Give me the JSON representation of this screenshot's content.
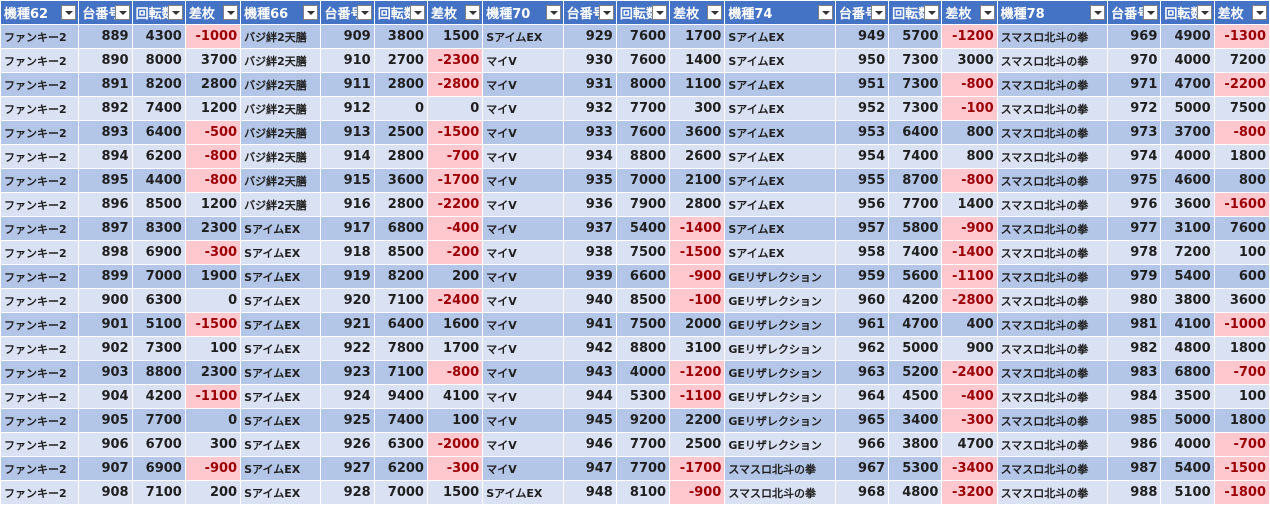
{
  "headers": [
    "機種62",
    "台番号",
    "回転数",
    "差枚",
    "機種66",
    "台番号",
    "回転数",
    "差枚",
    "機種70",
    "台番号",
    "回転数",
    "差枚",
    "機種74",
    "台番号",
    "回転数",
    "差枚",
    "機種78",
    "台番号",
    "回転数",
    "差枚"
  ],
  "neg_fill_color": "#ffc7ce",
  "header_color": "#4472c4",
  "rows": [
    [
      "ファンキー2",
      "889",
      "4300",
      "-1000",
      "バジ絆2天膳",
      "909",
      "3800",
      "1500",
      "SアイムEX",
      "929",
      "7600",
      "1700",
      "SアイムEX",
      "949",
      "5700",
      "-1200",
      "スマスロ北斗の拳",
      "969",
      "4900",
      "-1300"
    ],
    [
      "ファンキー2",
      "890",
      "8000",
      "3700",
      "バジ絆2天膳",
      "910",
      "2700",
      "-2300",
      "マイV",
      "930",
      "7600",
      "1400",
      "SアイムEX",
      "950",
      "7300",
      "3000",
      "スマスロ北斗の拳",
      "970",
      "4000",
      "7200"
    ],
    [
      "ファンキー2",
      "891",
      "8200",
      "2800",
      "バジ絆2天膳",
      "911",
      "2800",
      "-2800",
      "マイV",
      "931",
      "8000",
      "1100",
      "SアイムEX",
      "951",
      "7300",
      "-800",
      "スマスロ北斗の拳",
      "971",
      "4700",
      "-2200"
    ],
    [
      "ファンキー2",
      "892",
      "7400",
      "1200",
      "バジ絆2天膳",
      "912",
      "0",
      "0",
      "マイV",
      "932",
      "7700",
      "300",
      "SアイムEX",
      "952",
      "7300",
      "-100",
      "スマスロ北斗の拳",
      "972",
      "5000",
      "7500"
    ],
    [
      "ファンキー2",
      "893",
      "6400",
      "-500",
      "バジ絆2天膳",
      "913",
      "2500",
      "-1500",
      "マイV",
      "933",
      "7600",
      "3600",
      "SアイムEX",
      "953",
      "6400",
      "800",
      "スマスロ北斗の拳",
      "973",
      "3700",
      "-800"
    ],
    [
      "ファンキー2",
      "894",
      "6200",
      "-800",
      "バジ絆2天膳",
      "914",
      "2800",
      "-700",
      "マイV",
      "934",
      "8800",
      "2600",
      "SアイムEX",
      "954",
      "7400",
      "800",
      "スマスロ北斗の拳",
      "974",
      "4000",
      "1800"
    ],
    [
      "ファンキー2",
      "895",
      "4400",
      "-800",
      "バジ絆2天膳",
      "915",
      "3600",
      "-1700",
      "マイV",
      "935",
      "7000",
      "2100",
      "SアイムEX",
      "955",
      "8700",
      "-800",
      "スマスロ北斗の拳",
      "975",
      "4600",
      "800"
    ],
    [
      "ファンキー2",
      "896",
      "8500",
      "1200",
      "バジ絆2天膳",
      "916",
      "2800",
      "-2200",
      "マイV",
      "936",
      "7900",
      "2800",
      "SアイムEX",
      "956",
      "7700",
      "1400",
      "スマスロ北斗の拳",
      "976",
      "3600",
      "-1600"
    ],
    [
      "ファンキー2",
      "897",
      "8300",
      "2300",
      "SアイムEX",
      "917",
      "6800",
      "-400",
      "マイV",
      "937",
      "5400",
      "-1400",
      "SアイムEX",
      "957",
      "5800",
      "-900",
      "スマスロ北斗の拳",
      "977",
      "3100",
      "7600"
    ],
    [
      "ファンキー2",
      "898",
      "6900",
      "-300",
      "SアイムEX",
      "918",
      "8500",
      "-200",
      "マイV",
      "938",
      "7500",
      "-1500",
      "SアイムEX",
      "958",
      "7400",
      "-1400",
      "スマスロ北斗の拳",
      "978",
      "7200",
      "100"
    ],
    [
      "ファンキー2",
      "899",
      "7000",
      "1900",
      "SアイムEX",
      "919",
      "8200",
      "200",
      "マイV",
      "939",
      "6600",
      "-900",
      "GEリザレクション",
      "959",
      "5600",
      "-1100",
      "スマスロ北斗の拳",
      "979",
      "5400",
      "600"
    ],
    [
      "ファンキー2",
      "900",
      "6300",
      "0",
      "SアイムEX",
      "920",
      "7100",
      "-2400",
      "マイV",
      "940",
      "8500",
      "-100",
      "GEリザレクション",
      "960",
      "4200",
      "-2800",
      "スマスロ北斗の拳",
      "980",
      "3800",
      "3600"
    ],
    [
      "ファンキー2",
      "901",
      "5100",
      "-1500",
      "SアイムEX",
      "921",
      "6400",
      "1600",
      "マイV",
      "941",
      "7500",
      "2000",
      "GEリザレクション",
      "961",
      "4700",
      "400",
      "スマスロ北斗の拳",
      "981",
      "4100",
      "-1000"
    ],
    [
      "ファンキー2",
      "902",
      "7300",
      "100",
      "SアイムEX",
      "922",
      "7800",
      "1700",
      "マイV",
      "942",
      "8800",
      "3100",
      "GEリザレクション",
      "962",
      "5000",
      "900",
      "スマスロ北斗の拳",
      "982",
      "4800",
      "1800"
    ],
    [
      "ファンキー2",
      "903",
      "8800",
      "2300",
      "SアイムEX",
      "923",
      "7100",
      "-800",
      "マイV",
      "943",
      "4000",
      "-1200",
      "GEリザレクション",
      "963",
      "5200",
      "-2400",
      "スマスロ北斗の拳",
      "983",
      "6800",
      "-700"
    ],
    [
      "ファンキー2",
      "904",
      "4200",
      "-1100",
      "SアイムEX",
      "924",
      "9400",
      "4100",
      "マイV",
      "944",
      "5300",
      "-1100",
      "GEリザレクション",
      "964",
      "4500",
      "-400",
      "スマスロ北斗の拳",
      "984",
      "3500",
      "100"
    ],
    [
      "ファンキー2",
      "905",
      "7700",
      "0",
      "SアイムEX",
      "925",
      "7400",
      "100",
      "マイV",
      "945",
      "9200",
      "2200",
      "GEリザレクション",
      "965",
      "3400",
      "-300",
      "スマスロ北斗の拳",
      "985",
      "5000",
      "1800"
    ],
    [
      "ファンキー2",
      "906",
      "6700",
      "300",
      "SアイムEX",
      "926",
      "6300",
      "-2000",
      "マイV",
      "946",
      "7700",
      "2500",
      "GEリザレクション",
      "966",
      "3800",
      "4700",
      "スマスロ北斗の拳",
      "986",
      "4000",
      "-700"
    ],
    [
      "ファンキー2",
      "907",
      "6900",
      "-900",
      "SアイムEX",
      "927",
      "6200",
      "-300",
      "マイV",
      "947",
      "7700",
      "-1700",
      "スマスロ北斗の拳",
      "967",
      "5300",
      "-3400",
      "スマスロ北斗の拳",
      "987",
      "5400",
      "-1500"
    ],
    [
      "ファンキー2",
      "908",
      "7100",
      "200",
      "SアイムEX",
      "928",
      "7000",
      "1500",
      "SアイムEX",
      "948",
      "8100",
      "-900",
      "スマスロ北斗の拳",
      "968",
      "4800",
      "-3200",
      "スマスロ北斗の拳",
      "988",
      "5100",
      "-1800"
    ]
  ]
}
